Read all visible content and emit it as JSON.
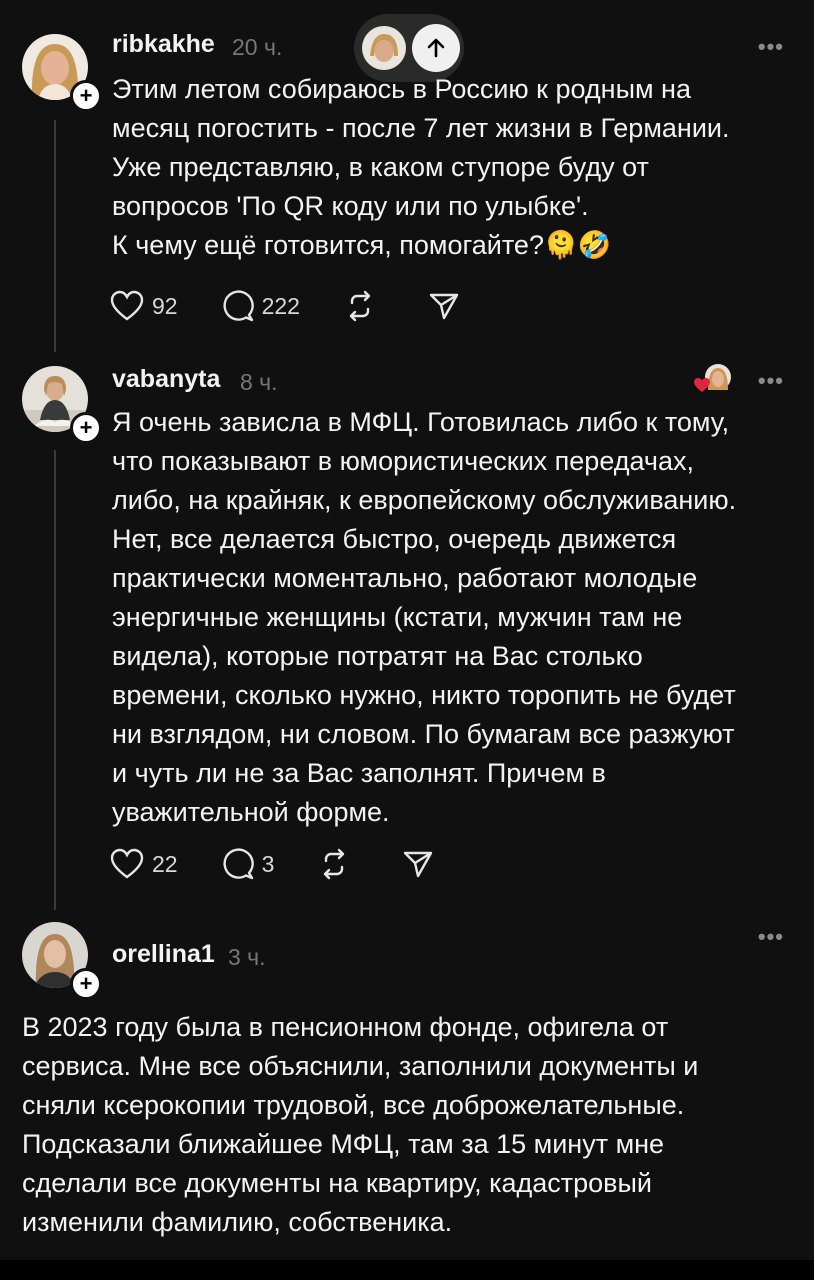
{
  "colors": {
    "background": "#101010",
    "text": "#f3f3f3",
    "muted": "#777777",
    "heart": "#e0263f"
  },
  "posts": [
    {
      "username": "ribkakhe",
      "time": "20 ч.",
      "text": "Этим летом собираюсь в Россию к родным на\nмесяц погостить - после 7 лет жизни в Германии.\nУже представляю, в каком ступоре буду от\nвопросов 'По QR коду или по улыбке'.\nК чему ещё готовится, помогайте?🫠🤣",
      "likes": "92",
      "replies": "222"
    },
    {
      "username": "vabanyta",
      "time": "8 ч.",
      "text": "Я очень зависла в МФЦ. Готовилась либо к тому,\nчто показывают в юмористических передачах,\nлибо, на крайняк, к европейскому обслуживанию.\nНет, все делается быстро, очередь движется\nпрактически моментально, работают молодые\nэнергичные женщины (кстати, мужчин там не\nвидела), которые потратят на Вас столько\nвремени, сколько нужно, никто торопить не будет\nни взглядом, ни словом. По бумагам все разжуют\nи чуть ли не за Вас заполнят. Причем в\nуважительной форме.",
      "likes": "22",
      "replies": "3"
    },
    {
      "username": "orellina1",
      "time": "3 ч.",
      "text": "В 2023 году была в пенсионном фонде, офигела от\nсервиса. Мне все объяснили, заполнили документы и\nсняли ксерокопии трудовой, все доброжелательные.\nПодсказали ближайшее МФЦ, там за 15 минут мне\nсделали все документы на квартиру, кадастровый\nизменили фамилию, собственика."
    }
  ],
  "icons": {
    "more": "•••",
    "plus": "+",
    "like": "heart-icon",
    "reply": "comment-icon",
    "repost": "repost-icon",
    "share": "send-icon",
    "scroll_up": "arrow-up-icon"
  }
}
